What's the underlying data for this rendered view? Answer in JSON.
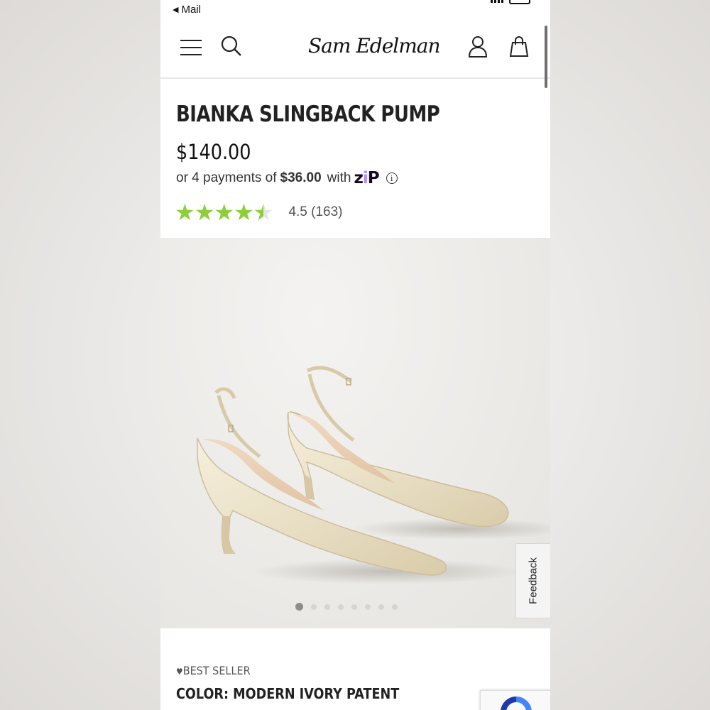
{
  "status_bar": {
    "back_label": "Mail"
  },
  "header": {
    "brand": "Sam Edelman",
    "icons": [
      "menu-icon",
      "search-icon",
      "account-icon",
      "shopping-bag-icon"
    ]
  },
  "product": {
    "title": "BIANKA SLINGBACK PUMP",
    "price": "$140.00",
    "installment": {
      "prefix": "or 4 payments of",
      "amount": "$36.00",
      "suffix": "with",
      "provider": "zip"
    },
    "rating": {
      "value": 4.5,
      "max": 5,
      "label": "4.5 (163)"
    },
    "badge": "BEST SELLER",
    "color_label": "COLOR:",
    "color_value": "MODERN IVORY PATENT"
  },
  "gallery": {
    "image_count": 8,
    "active_index": 0
  },
  "feedback": {
    "label": "Feedback"
  },
  "colors": {
    "star": "#8ccf3a",
    "zip_dark": "#1a0826",
    "zip_accent": "#aa8fff",
    "shoe": "#ece3cc"
  }
}
